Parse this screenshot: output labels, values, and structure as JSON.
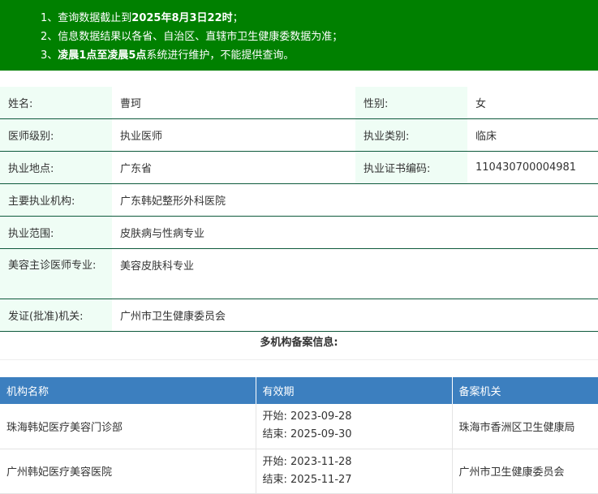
{
  "notice": {
    "line1_prefix": "1、查询数据截止到",
    "line1_bold": "2025年8月3日22时",
    "line1_suffix": "；",
    "line2": "2、信息数据结果以各省、自治区、直辖市卫生健康委数据为准；",
    "line3_prefix": "3、",
    "line3_bold": "凌晨1点至凌晨5点",
    "line3_suffix": "系统进行维护，不能提供查询。"
  },
  "info": {
    "name_label": "姓名:",
    "name_value": "曹珂",
    "gender_label": "性别:",
    "gender_value": "女",
    "level_label": "医师级别:",
    "level_value": "执业医师",
    "category_label": "执业类别:",
    "category_value": "临床",
    "location_label": "执业地点:",
    "location_value": "广东省",
    "cert_label": "执业证书编码:",
    "cert_value": "110430700004981",
    "institution_label": "主要执业机构:",
    "institution_value": "广东韩妃整形外科医院",
    "scope_label": "执业范围:",
    "scope_value": "皮肤病与性病专业",
    "cosmetic_label": "美容主诊医师专业:",
    "cosmetic_value": "美容皮肤科专业",
    "issuer_label": "发证(批准)机关:",
    "issuer_value": "广州市卫生健康委员会"
  },
  "multi": {
    "title": "多机构备案信息:",
    "headers": [
      "机构名称",
      "有效期",
      "备案机关"
    ],
    "rows": [
      {
        "institution": "珠海韩妃医疗美容门诊部",
        "start": "开始:  2023-09-28",
        "end": "结束:  2025-09-30",
        "authority": "珠海市香洲区卫生健康局"
      },
      {
        "institution": "广州韩妃医疗美容医院",
        "start": "开始:  2023-11-28",
        "end": "结束:  2025-11-27",
        "authority": "广州市卫生健康委员会"
      }
    ]
  }
}
